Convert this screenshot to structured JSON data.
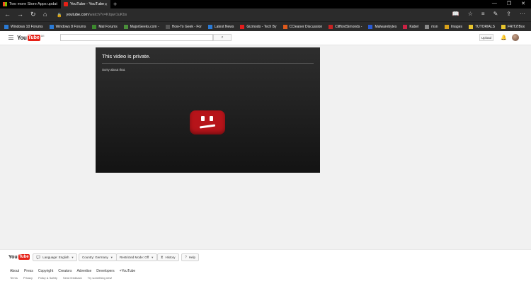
{
  "browser": {
    "tabs": [
      {
        "label": "Two more Store Apps updat"
      },
      {
        "label": "YouTube - YouTube"
      }
    ],
    "address": {
      "host": "youtube.com",
      "path": "/watch?v=Klqwr1uKbs"
    },
    "favorites": [
      {
        "label": "Windows 10 Forums",
        "color": "#2a7ad5"
      },
      {
        "label": "Windows 8 Forums",
        "color": "#2a7ad5"
      },
      {
        "label": "Mal Forums",
        "color": "#3c8a2e"
      },
      {
        "label": "MajorGeeks.com -",
        "color": "#4a8f3a"
      },
      {
        "label": "How-To Geek - For",
        "color": "#555555"
      },
      {
        "label": "Latest News",
        "color": "#2a7ad5"
      },
      {
        "label": "Gizmodo - Tech By",
        "color": "#e31c1c"
      },
      {
        "label": "CCleaner Discussion",
        "color": "#e05a1c"
      },
      {
        "label": "CliffordSimonds -",
        "color": "#c82323"
      },
      {
        "label": "Malwarebytes",
        "color": "#2a5bd5"
      },
      {
        "label": "Kabel",
        "color": "#cc2244"
      },
      {
        "label": "msn",
        "color": "#888888"
      },
      {
        "label": "Images",
        "color": "#d9a21a"
      },
      {
        "label": "TUTORIALS",
        "color": "#e8c52e"
      },
      {
        "label": "FRITZ!Box",
        "color": "#e8c52e"
      }
    ]
  },
  "youtube": {
    "logo_you": "You",
    "logo_tube": "Tube",
    "logo_sup": "DE",
    "upload_label": "Upload"
  },
  "player": {
    "title": "This video is private.",
    "subtitle": "Sorry about that."
  },
  "footer": {
    "logo_you": "You",
    "logo_tube": "Tube",
    "language": "Language: English",
    "country": "Country: Germany",
    "restricted": "Restricted Mode: Off",
    "history": "History",
    "help": "Help",
    "links_primary": [
      "About",
      "Press",
      "Copyright",
      "Creators",
      "Advertise",
      "Developers",
      "+YouTube"
    ],
    "links_secondary": [
      "Terms",
      "Privacy",
      "Policy & Safety",
      "Send feedback",
      "Try something new!"
    ]
  },
  "colors": {
    "brand_red": "#e62117",
    "error_red": "#b7141a"
  }
}
